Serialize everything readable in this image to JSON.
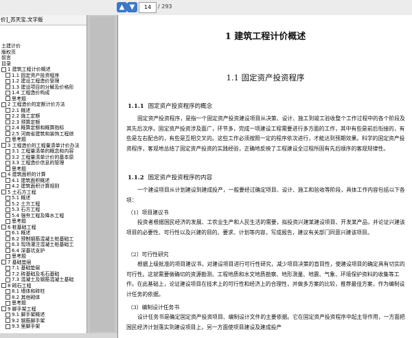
{
  "toolbar": {
    "page_current": "14",
    "page_total": "/ 293"
  },
  "sidebar": {
    "title": "价]_苏天宝.文字版",
    "items": [
      {
        "check": false,
        "level": 1,
        "label": "土建计价"
      },
      {
        "check": false,
        "level": 1,
        "label": "版权页"
      },
      {
        "check": false,
        "level": 1,
        "label": "前言"
      },
      {
        "check": false,
        "level": 1,
        "label": "目录"
      },
      {
        "check": true,
        "level": 1,
        "label": "1  建筑工程计价概述"
      },
      {
        "check": true,
        "level": 2,
        "label": "1.1  固定资产投资程序"
      },
      {
        "check": true,
        "level": 2,
        "label": "1.2  建设工程造价管理"
      },
      {
        "check": true,
        "level": 2,
        "label": "1.3  建设项目的分解及价格形"
      },
      {
        "check": true,
        "level": 2,
        "label": "1.4  工程造价构成"
      },
      {
        "check": true,
        "level": 2,
        "label": "思考题"
      },
      {
        "check": true,
        "level": 1,
        "label": "2  工程造价的定额计价方法"
      },
      {
        "check": true,
        "level": 2,
        "label": "2.1  概述"
      },
      {
        "check": true,
        "level": 2,
        "label": "2.2  施工定额"
      },
      {
        "check": true,
        "level": 2,
        "label": "2.3  预算定额"
      },
      {
        "check": true,
        "level": 2,
        "label": "2.4  概算定额和概算指标"
      },
      {
        "check": true,
        "level": 2,
        "label": "2.5  河南省建筑和装饰工程综"
      },
      {
        "check": true,
        "level": 2,
        "label": "思考题"
      },
      {
        "check": true,
        "level": 1,
        "label": "3  工程造价的工程量清单计价办法"
      },
      {
        "check": true,
        "level": 2,
        "label": "3.1  工程量清单的概念和内容"
      },
      {
        "check": true,
        "level": 2,
        "label": "3.2  工程量清单计价的基本原"
      },
      {
        "check": true,
        "level": 2,
        "label": "3.3  工程造价信息的管理"
      },
      {
        "check": true,
        "level": 2,
        "label": "思考题"
      },
      {
        "check": true,
        "level": 1,
        "label": "4  建筑面积的计算"
      },
      {
        "check": true,
        "level": 2,
        "label": "4.1  建筑面积概述"
      },
      {
        "check": true,
        "level": 2,
        "label": "4.2  建筑面积计算规则"
      },
      {
        "check": true,
        "level": 1,
        "label": "5  土石方工程"
      },
      {
        "check": true,
        "level": 2,
        "label": "5.1  概述"
      },
      {
        "check": true,
        "level": 2,
        "label": "5.2  土方工程"
      },
      {
        "check": true,
        "level": 2,
        "label": "5.3  石方工程"
      },
      {
        "check": true,
        "level": 2,
        "label": "5.4  强夯工程及降水工程"
      },
      {
        "check": true,
        "level": 2,
        "label": "思考题"
      },
      {
        "check": true,
        "level": 1,
        "label": "6  桩基础工程"
      },
      {
        "check": true,
        "level": 2,
        "label": "6.1  概述"
      },
      {
        "check": true,
        "level": 2,
        "label": "6.2  预制钢筋混凝土桩基础工"
      },
      {
        "check": true,
        "level": 2,
        "label": "6.3  现场灌注混凝土桩基础工"
      },
      {
        "check": true,
        "level": 2,
        "label": "6.4  深基坑支护"
      },
      {
        "check": true,
        "level": 2,
        "label": "思考题"
      },
      {
        "check": true,
        "level": 1,
        "label": "7  基础垫层"
      },
      {
        "check": true,
        "level": 2,
        "label": "7.1  基础垫层"
      },
      {
        "check": true,
        "level": 2,
        "label": "7.2  砖基础及毛石基础"
      },
      {
        "check": true,
        "level": 2,
        "label": "7.3  混凝土及钢筋混凝土基础"
      },
      {
        "check": true,
        "level": 1,
        "label": "8  砌石工程"
      },
      {
        "check": true,
        "level": 2,
        "label": "8.1  墙体和砖柱"
      },
      {
        "check": true,
        "level": 2,
        "label": "8.2  其他砌体"
      },
      {
        "check": true,
        "level": 2,
        "label": "思考题"
      },
      {
        "check": true,
        "level": 1,
        "label": "9  脚手架工程"
      },
      {
        "check": true,
        "level": 2,
        "label": "9.1  脚手架概述"
      },
      {
        "check": true,
        "level": 2,
        "label": "9.2  钢筋脚手架"
      },
      {
        "check": true,
        "level": 2,
        "label": "9.3  里脚手架"
      }
    ]
  },
  "document": {
    "chapter_title": "1   建筑工程计价概述",
    "section_title": "1.1   固定资产投资程序",
    "sub1": {
      "num": "1.1.1",
      "title": "固定资产投资程序的概念"
    },
    "para1": "固定资产投资程序，是指一个固定资产投资建设项目从决策、设计、施工到竣工验收整个工作过程中的各个阶段及其先后次序。固定资产投资涉及面广，环节多，完成一项建设工程需要进行多方面的工作，其中有些是前后衔接的，有些是左右配合的，有些是互相交叉的。这些工作必须按照一定的程序依次进行，才能达到预期效果。科学的固定资产投资程序，客观地总结了固定资产投资的实践经验，正确地反映了工程建设全过程所固有先后顺序的客观规律性。",
    "sub2": {
      "num": "1.1.2",
      "title": "固定资产投资程序的内容"
    },
    "para2": "一个建设项目从计划建设到建成投产，一般要经过确定项目、设计、施工和验收等阶段，具体工作内容包括以下各项：",
    "item1_title": "（1）项目建议书",
    "para3": "投资者根据国民经济的发展、工农业生产和人民生活的需要，拟投资兴建某建设项目、开发某产品，并论证兴建该项目的必要性、可行性以及兴建的目的、要求、计划等内容，写成报告，建议有关部门同意兴建该项目。",
    "item2_title": "（2）可行性研究",
    "para4": "根据上级批准的项目建议书，对建设项目进行可行性研究，减少项目决策的盲目性，使建设项目的确定具有切实的可行性。这就需要做确切的资源勘测、工程地质和水文地质勘察、地形测量、地震、气象、环境保护资料的收集等工作。在此基础上，论证建设项目在技术上的可行性和经济上的合理性，并做多方案的比较，推荐最佳方案，作为编制设计任务的依据。",
    "item3_title": "（3）编制设计任务书",
    "para5": "设计任务书是确定固定资产投资项目、编制设计文件的主要依据。它在固定资产投资程序中起主导作用，一方面把国民经济计划落实到建设项目上，另一方面使项目建设及建成投产"
  }
}
